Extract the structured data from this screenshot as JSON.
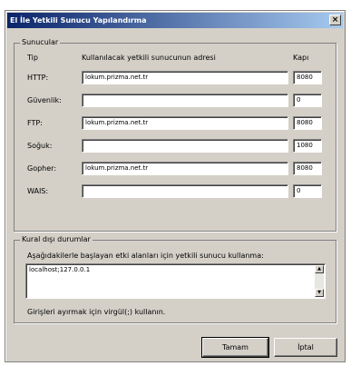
{
  "window": {
    "title": "El İle Yetkili Sunucu Yapılandırma",
    "close_glyph": "×"
  },
  "servers": {
    "legend": "Sunucular",
    "col_type": "Tip",
    "col_address": "Kullanılacak yetkili sunucunun adresi",
    "col_port": "Kapı",
    "rows": [
      {
        "label": "HTTP:",
        "address": "lokum.prizma.net.tr",
        "port": "8080"
      },
      {
        "label": "Güvenlik:",
        "address": "",
        "port": "0"
      },
      {
        "label": "FTP:",
        "address": "lokum.prizma.net.tr",
        "port": "8080"
      },
      {
        "label": "Soğuk:",
        "address": "",
        "port": "1080"
      },
      {
        "label": "Gopher:",
        "address": "lokum.prizma.net.tr",
        "port": "8080"
      },
      {
        "label": "WAIS:",
        "address": "",
        "port": "0"
      }
    ]
  },
  "exceptions": {
    "legend": "Kural dışı durumlar",
    "description": "Aşağıdakilerle başlayan etki alanları için yetkili sunucu kullanma:",
    "value": "localhost;127.0.0.1",
    "hint": "Girişleri ayırmak için virgül(;) kullanın."
  },
  "buttons": {
    "ok": "Tamam",
    "cancel": "İptal"
  }
}
